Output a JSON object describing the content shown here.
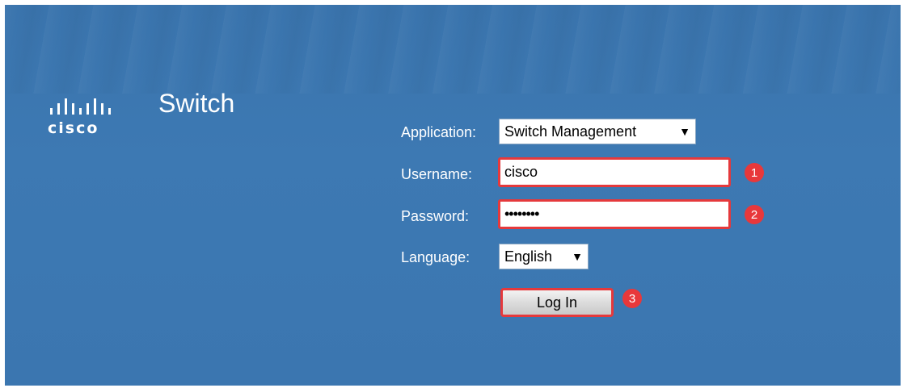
{
  "header": {
    "brand": "cisco",
    "product_title": "Switch"
  },
  "form": {
    "application": {
      "label": "Application:",
      "selected": "Switch Management"
    },
    "username": {
      "label": "Username:",
      "value": "cisco",
      "step": "1"
    },
    "password": {
      "label": "Password:",
      "value": "••••••••",
      "step": "2"
    },
    "language": {
      "label": "Language:",
      "selected": "English"
    },
    "login": {
      "label": "Log In",
      "step": "3"
    }
  },
  "icons": {
    "logo": "cisco-bars-icon",
    "dropdown": "triangle-down-icon"
  },
  "colors": {
    "background": "#3d79b3",
    "highlight": "#e5393c",
    "badge": "#e8383b"
  }
}
